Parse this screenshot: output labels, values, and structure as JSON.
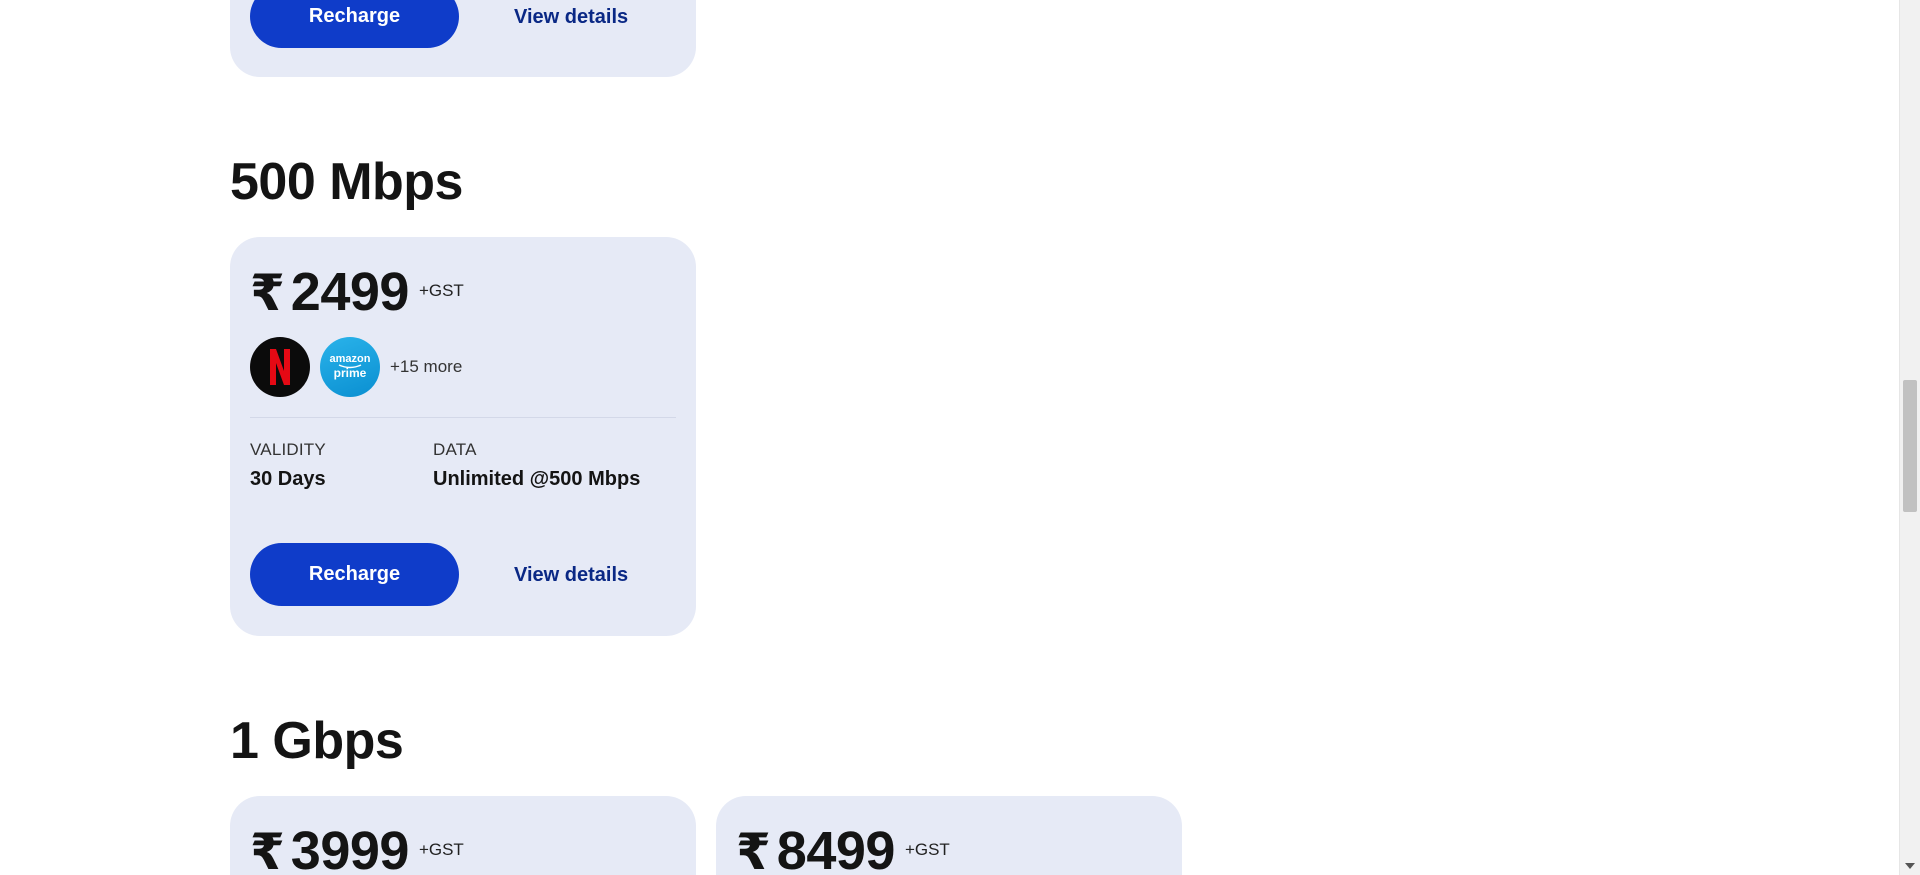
{
  "top_card": {
    "recharge_label": "Recharge",
    "details_label": "View details"
  },
  "section_500": {
    "title": "500 Mbps",
    "plan": {
      "currency": "₹",
      "amount": "2499",
      "tax": "+GST",
      "ott_apps": [
        "Netflix",
        "amazon prime"
      ],
      "more": "+15 more",
      "validity_label": "VALIDITY",
      "validity_value": "30 Days",
      "data_label": "DATA",
      "data_value": "Unlimited @500 Mbps",
      "recharge_label": "Recharge",
      "details_label": "View details"
    }
  },
  "section_1g": {
    "title": "1 Gbps",
    "plans": [
      {
        "currency": "₹",
        "amount": "3999",
        "tax": "+GST"
      },
      {
        "currency": "₹",
        "amount": "8499",
        "tax": "+GST"
      }
    ]
  },
  "colors": {
    "card_bg": "#e6eaf6",
    "button_bg": "#0f3cc9",
    "link": "#0a2885",
    "netflix_red": "#e50914"
  },
  "icons": {
    "netflix": "netflix-logo-icon",
    "prime": "amazon-prime-logo-icon"
  }
}
